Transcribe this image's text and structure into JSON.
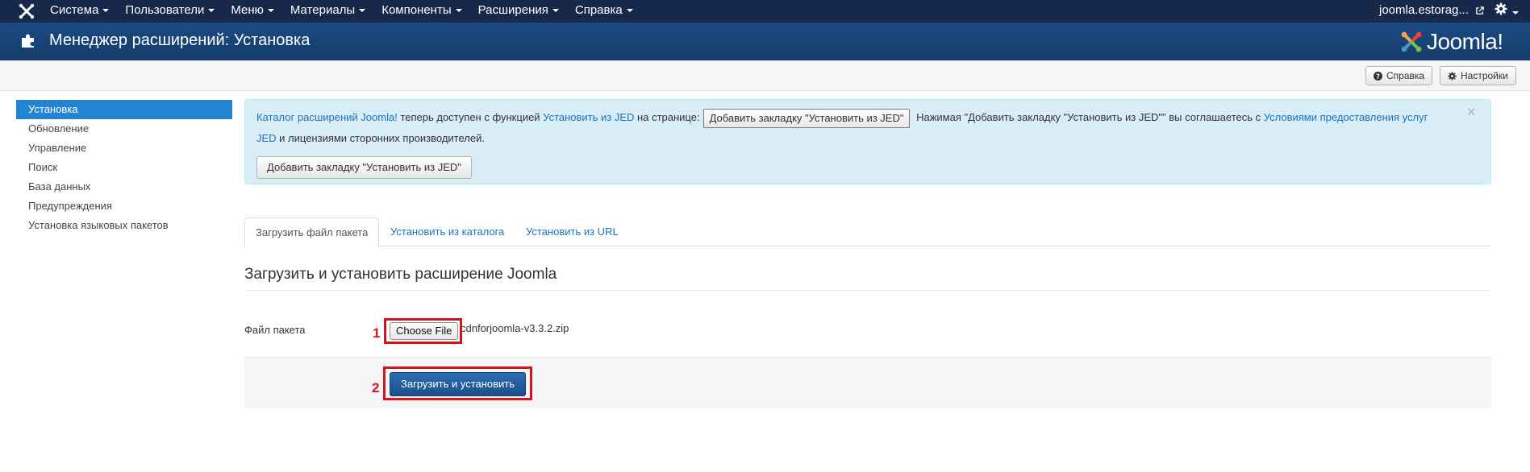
{
  "navbar": {
    "menu": [
      "Система",
      "Пользователи",
      "Меню",
      "Материалы",
      "Компоненты",
      "Расширения",
      "Справка"
    ],
    "site": "joomla.estorag..."
  },
  "header": {
    "title": "Менеджер расширений: Установка",
    "brand": "Joomla!"
  },
  "toolbar": {
    "help_label": "Справка",
    "options_label": "Настройки"
  },
  "sidebar": {
    "items": [
      "Установка",
      "Обновление",
      "Управление",
      "Поиск",
      "База данных",
      "Предупреждения",
      "Установка языковых пакетов"
    ]
  },
  "alert": {
    "link1": "Каталог расширений Joomla!",
    "text1": " теперь доступен с функцией ",
    "link2": "Установить из JED",
    "text2": " на странице:",
    "inline_button": "Добавить закладку \"Установить из JED\"",
    "text3": " Нажимая \"Добавить закладку \"Установить из JED\"\" вы соглашаетесь с ",
    "link3a": "Условиями предоставления услуг",
    "link3b": "JED",
    "text4": " и лицензиями сторонних производителей.",
    "button": "Добавить закладку \"Установить из JED\"",
    "close": "×"
  },
  "tabs": [
    "Загрузить файл пакета",
    "Установить из каталога",
    "Установить из URL"
  ],
  "form": {
    "section_title": "Загрузить и установить расширение Joomla",
    "field_label": "Файл пакета",
    "file_button": "Choose File",
    "file_name": "cdnforjoomla-v3.3.2.zip",
    "submit": "Загрузить и установить"
  },
  "annotations": [
    "1",
    "2"
  ],
  "colors": {
    "navbar": "#17294a",
    "header": "#1b4a82",
    "sidebar_active": "#2384d3",
    "alert_bg": "#d9edf7",
    "link": "#1a73bc",
    "primary_button": "#1d4f89",
    "annotation": "#d4161c"
  }
}
